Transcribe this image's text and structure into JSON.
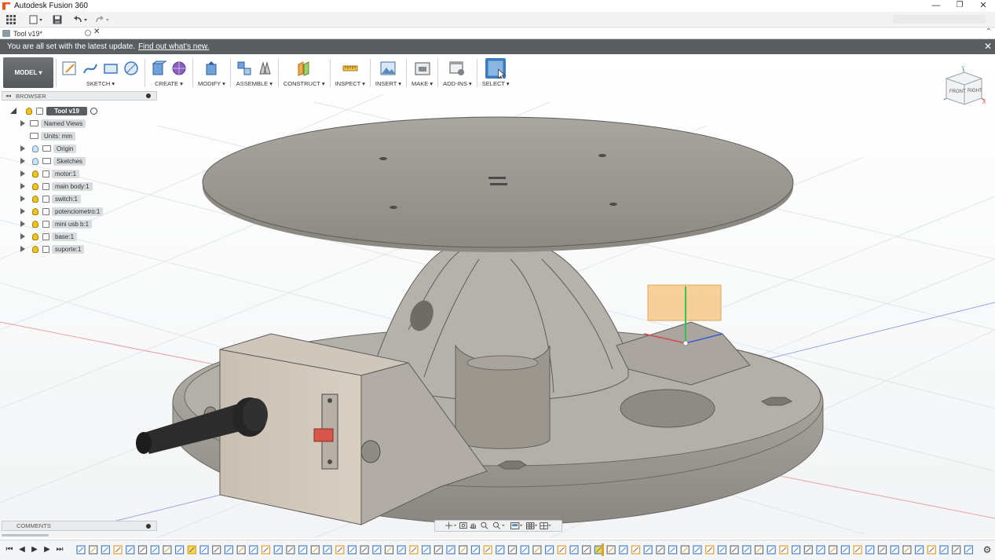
{
  "window": {
    "title": "Autodesk Fusion 360",
    "controls": {
      "minimize": "—",
      "restore": "❐",
      "close": "✕"
    }
  },
  "quick_access": {
    "grid_icon": "app-grid-icon",
    "file_icon": "file-icon",
    "save_icon": "save-icon",
    "undo_icon": "undo-icon",
    "redo_icon": "redo-icon"
  },
  "document_tab": {
    "label": "Tool v19*",
    "close": "✕",
    "right_arrow": "⌃"
  },
  "notification": {
    "message": "You are all set with the latest update.",
    "link": "Find out what's new.",
    "close": "✕"
  },
  "ribbon": {
    "workspace": "MODEL ▾",
    "groups": [
      {
        "label": "SKETCH ▾"
      },
      {
        "label": "CREATE ▾"
      },
      {
        "label": "MODIFY ▾"
      },
      {
        "label": "ASSEMBLE ▾"
      },
      {
        "label": "CONSTRUCT ▾"
      },
      {
        "label": "INSPECT ▾"
      },
      {
        "label": "INSERT ▾"
      },
      {
        "label": "MAKE ▾"
      },
      {
        "label": "ADD-INS ▾"
      },
      {
        "label": "SELECT ▾"
      }
    ]
  },
  "viewcube": {
    "front": "FRONT",
    "right": "RIGHT",
    "x": "X",
    "y": "Y",
    "z": "Z"
  },
  "browser": {
    "title": "BROWSER",
    "collapse": "◂◂",
    "root": "Tool v19",
    "items": [
      {
        "label": "Named Views"
      },
      {
        "label": "Units: mm"
      },
      {
        "label": "Origin"
      },
      {
        "label": "Sketches"
      },
      {
        "label": "motor:1"
      },
      {
        "label": "main body:1"
      },
      {
        "label": "switch:1"
      },
      {
        "label": "potenciometro:1"
      },
      {
        "label": "mini usb b:1"
      },
      {
        "label": "base:1"
      },
      {
        "label": "suporte:1"
      }
    ]
  },
  "comments": {
    "title": "COMMENTS"
  },
  "timeline": {
    "first": "⏮",
    "prev": "◀",
    "play": "▶",
    "next": "▶",
    "last": "⏭",
    "settings": "⚙"
  },
  "colors": {
    "notification_bg": "#5b5e61",
    "model_body": "#b9b5af",
    "model_dark": "#8c8883",
    "grid_line": "#dfe3e6",
    "accent_orange": "#f5c27a"
  }
}
